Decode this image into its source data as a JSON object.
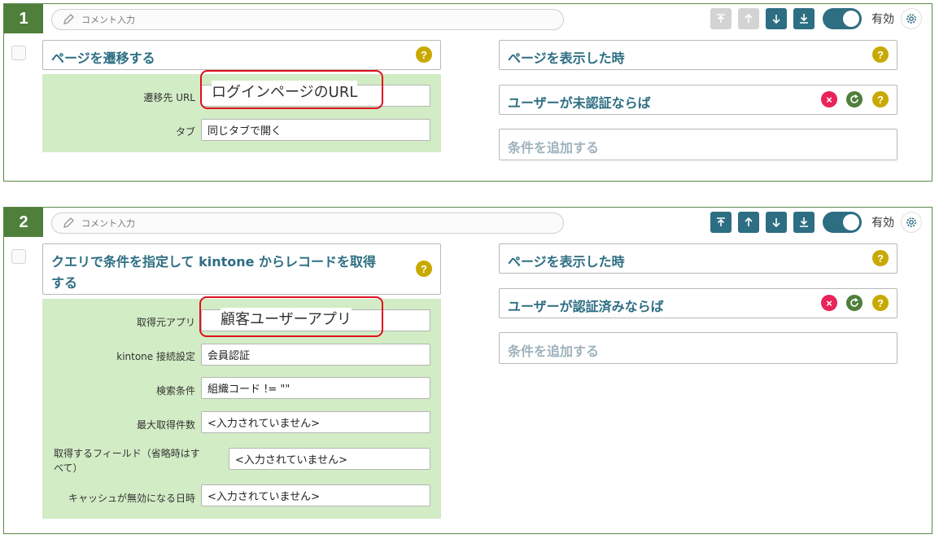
{
  "common": {
    "comment_placeholder": "コメント入力",
    "valid_label": "有効",
    "help_glyph": "?",
    "remove_glyph": "×"
  },
  "blocks": [
    {
      "number": "1",
      "action_title": "ページを遷移する",
      "fields": [
        {
          "label": "遷移先 URL",
          "value": ""
        },
        {
          "label": "タブ",
          "value": "同じタブで開く"
        }
      ],
      "highlight_text": "ログインページのURL",
      "trigger": "ページを表示した時",
      "condition": "ユーザーが未認証ならば",
      "add_condition": "条件を追加する"
    },
    {
      "number": "2",
      "action_title_line1": "クエリで条件を指定して kintone からレコードを取得",
      "action_title_line2": "する",
      "fields": [
        {
          "label": "取得元アプリ",
          "value": ""
        },
        {
          "label": "kintone 接続設定",
          "value": "会員認証"
        },
        {
          "label": "検索条件",
          "value": "組織コード != \"\""
        },
        {
          "label": "最大取得件数",
          "value": "<入力されていません>"
        },
        {
          "label_line1": "取得するフィールド（省略時はす",
          "label_line2": "べて）",
          "value": "<入力されていません>"
        },
        {
          "label": "キャッシュが無効になる日時",
          "value": "<入力されていません>"
        }
      ],
      "highlight_text": "顧客ユーザーアプリ",
      "trigger": "ページを表示した時",
      "condition": "ユーザーが認証済みならば",
      "add_condition": "条件を追加する"
    }
  ],
  "colors": {
    "accent": "#2d6e83",
    "number_bg": "#4f7f3a",
    "panel_green": "#d2ecc5",
    "help_yellow": "#c8a900",
    "remove_red": "#e8245a",
    "highlight_red": "#e0101f"
  }
}
